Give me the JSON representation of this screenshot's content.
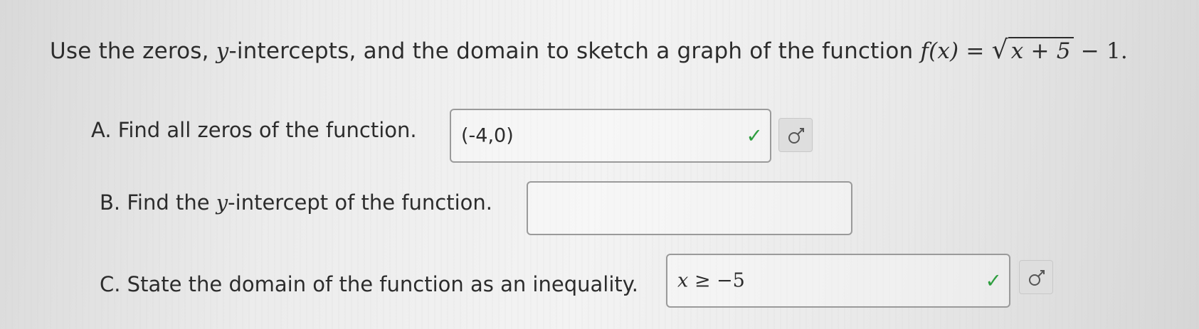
{
  "question": {
    "prefix": "Use the zeros, ",
    "y_var": "y",
    "middle": "-intercepts, and the domain to sketch a graph of the function ",
    "function_lhs": "f(x) = ",
    "sqrt_inner": "x + 5",
    "function_tail": " − 1."
  },
  "parts": [
    {
      "label": "A. Find all zeros of the function.",
      "answer": "(-4,0)",
      "status": "correct"
    },
    {
      "label_prefix": "B. Find the ",
      "label_var": "y",
      "label_suffix": "-intercept of the function.",
      "answer": "",
      "status": "empty"
    },
    {
      "label": "C. State the domain of the function as an inequality.",
      "answer_var": "x",
      "answer_rest": " ≥ −5",
      "status": "correct"
    }
  ],
  "icons": {
    "correct": "checkmark-icon",
    "sidebutton": "preview-icon"
  },
  "colors": {
    "check": "#2e9e3f",
    "box_border": "#9a9a9a",
    "text": "#2c2c2c"
  }
}
